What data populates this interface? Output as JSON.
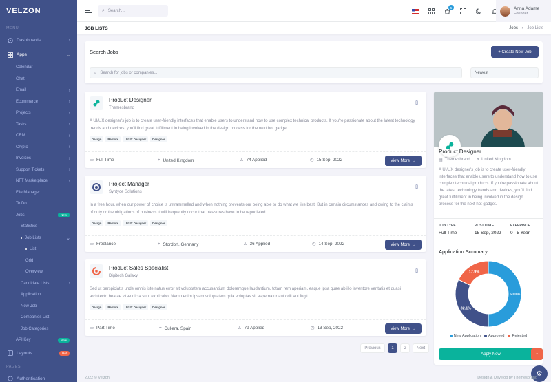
{
  "brand": "VELZON",
  "sidebar": {
    "menu_title": "MENU",
    "pages_title": "PAGES",
    "dashboards": "Dashboards",
    "apps": "Apps",
    "apps_items": [
      "Calendar",
      "Chat",
      "Email",
      "Ecommerce",
      "Projects",
      "Tasks",
      "CRM",
      "Crypto",
      "Invoices",
      "Support Tickets",
      "NFT Marketplace",
      "File Manager",
      "To Do"
    ],
    "jobs": "Jobs",
    "jobs_badge": "New",
    "statistics": "Statistics",
    "job_lists": "Job Lists",
    "job_lists_items": [
      "List",
      "Grid",
      "Overview"
    ],
    "after_items": [
      "Candidate Lists",
      "Application",
      "New Job",
      "Companies List",
      "Job Categories"
    ],
    "api_key": "API Key",
    "api_badge": "New",
    "layouts": "Layouts",
    "layouts_badge": "Hot",
    "authentication": "Authentication"
  },
  "topbar": {
    "search_placeholder": "Search...",
    "cart_count": "5",
    "notif_count": "3",
    "user_name": "Anna Adame",
    "user_role": "Founder"
  },
  "page": {
    "title": "JOB LISTS",
    "breadcrumb_parent": "Jobs",
    "breadcrumb_current": "Job Lists"
  },
  "search_card": {
    "title": "Search Jobs",
    "create_btn": "+ Create New Job",
    "input_placeholder": "Search for jobs or companies...",
    "sort": "Newest"
  },
  "jobs": [
    {
      "title": "Product Designer",
      "company": "Themesbrand",
      "desc": "A UI/UX designer's job is to create user-friendly interfaces that enable users to understand how to use complex technical products. If you're passionate about the latest technology trends and devices, you'll find great fulfillment in being involved in the design process for the next hot gadget.",
      "tags": [
        "Design",
        "Remote",
        "UI/UX Designer",
        "Designer"
      ],
      "type": "Full Time",
      "location": "United Kingdom",
      "applied": "74 Applied",
      "date": "15 Sep, 2022",
      "btn": "View More"
    },
    {
      "title": "Project Manager",
      "company": "Syntyce Solutions",
      "desc": "In a free hour, when our power of choice is untrammelled and when nothing prevents our being able to do what we like best. But in certain circumstances and owing to the claims of duty or the obligations of business it will frequently occur that pleasures have to be repudiated.",
      "tags": [
        "Design",
        "Remote",
        "UI/UX Designer",
        "Designer"
      ],
      "type": "Freelance",
      "location": "Stordorf, Germany",
      "applied": "36 Applied",
      "date": "14 Sep, 2022",
      "btn": "View More"
    },
    {
      "title": "Product Sales Specialist",
      "company": "Digitech Galaxy",
      "desc": "Sed ut perspiciatis unde omnis iste natus error sit voluptatem accusantium doloremque laudantium, totam rem aperiam, eaque ipsa quae ab illo inventore veritatis et quasi architecto beatae vitae dicta sunt explicabo. Nemo enim ipsam voluptatem quia voluptas sit aspernatur aut odit aut fugit.",
      "tags": [
        "Design",
        "Remote",
        "UI/UX Designer",
        "Designer"
      ],
      "type": "Part Time",
      "location": "Cullera, Spain",
      "applied": "79 Applied",
      "date": "13 Sep, 2022",
      "btn": "View More"
    }
  ],
  "pagination": {
    "prev": "Previous",
    "pages": [
      "1",
      "2"
    ],
    "next": "Next"
  },
  "detail": {
    "title": "Product Designer",
    "company": "Themesbrand",
    "location": "United Kingdom",
    "desc": "A UI/UX designer's job is to create user-friendly interfaces that enable users to understand how to use complex technical products. If you're passionate about the latest technology trends and devices, you'll find great fulfillment in being involved in the design process for the next hot gadget.",
    "meta_labels": [
      "JOB TYPE",
      "POST DATE",
      "EXPERINCE"
    ],
    "meta_values": [
      "Full Time",
      "15 Sep, 2022",
      "0 - 5 Year"
    ],
    "summary_title": "Application Summary",
    "apply_btn": "Apply Now"
  },
  "chart_data": {
    "type": "pie",
    "categories": [
      "New Application",
      "Approved",
      "Rejected"
    ],
    "values": [
      50.0,
      32.1,
      17.9
    ],
    "labels": [
      "50.0%",
      "32.1%",
      "17.9%"
    ],
    "colors": [
      "#299cdb",
      "#405189",
      "#f06548"
    ]
  },
  "footer": {
    "left": "2022 © Velzon.",
    "right": "Design & Develop by Themesbrand"
  }
}
